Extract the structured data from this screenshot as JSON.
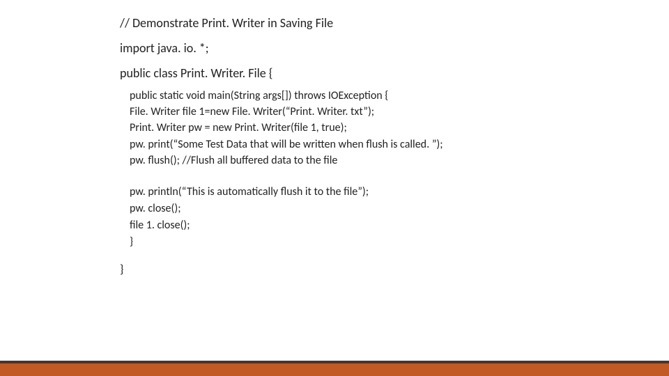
{
  "title": "// Demonstrate Print. Writer in Saving File",
  "import_line": "import java. io. *;",
  "class_decl": "public class Print. Writer. File {",
  "block1": {
    "l1": "public static void main(String args[]) throws IOException {",
    "l2": "File. Writer file 1=new File. Writer(“Print. Writer. txt”);",
    "l3": "Print. Writer pw = new Print. Writer(file 1, true);",
    "l4": "pw. print(“Some Test Data that will be written when flush is called. ”);",
    "l5": "pw. flush(); //Flush all buffered data to the file"
  },
  "block2": {
    "l1": "pw. println(“This is automatically flush it to the file”);",
    "l2": "pw. close();",
    "l3": "file 1. close();",
    "l4": "}"
  },
  "close_brace": "}"
}
